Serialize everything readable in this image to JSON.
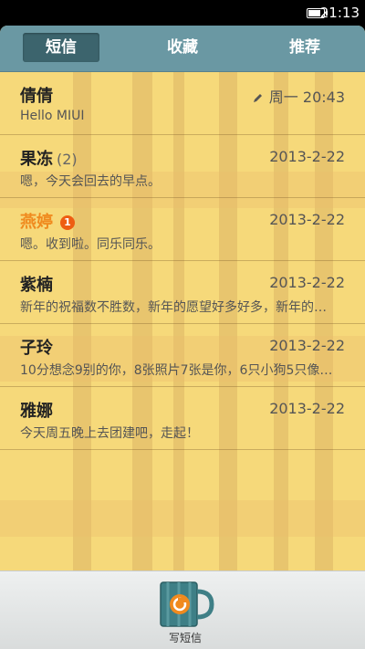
{
  "status": {
    "time": "21:13"
  },
  "tabs": [
    {
      "label": "短信"
    },
    {
      "label": "收藏"
    },
    {
      "label": "推荐"
    }
  ],
  "messages": [
    {
      "name": "倩倩",
      "count": "",
      "badge": "",
      "date": "周一 20:43",
      "preview": "Hello MIUI",
      "draft": true,
      "unread": false
    },
    {
      "name": "果冻",
      "count": "(2)",
      "badge": "",
      "date": "2013-2-22",
      "preview": "嗯，今天会回去的早点。",
      "draft": false,
      "unread": false
    },
    {
      "name": "燕婷",
      "count": "",
      "badge": "1",
      "date": "2013-2-22",
      "preview": "嗯。收到啦。同乐同乐。",
      "draft": false,
      "unread": true
    },
    {
      "name": "紫楠",
      "count": "",
      "badge": "",
      "date": "2013-2-22",
      "preview": "新年的祝福数不胜数，新年的愿望好多好多，新年的…",
      "draft": false,
      "unread": false
    },
    {
      "name": "子玲",
      "count": "",
      "badge": "",
      "date": "2013-2-22",
      "preview": "10分想念9别的你，8张照片7张是你，6只小狗5只像…",
      "draft": false,
      "unread": false
    },
    {
      "name": "雅娜",
      "count": "",
      "badge": "",
      "date": "2013-2-22",
      "preview": "今天周五晚上去团建吧，走起！",
      "draft": false,
      "unread": false
    }
  ],
  "bottom": {
    "compose_label": "写短信"
  },
  "colors": {
    "tabbar": "#6a98a3",
    "active_tab": "#3c646d",
    "unread_name": "#f08a1e",
    "badge": "#ee5d12"
  }
}
